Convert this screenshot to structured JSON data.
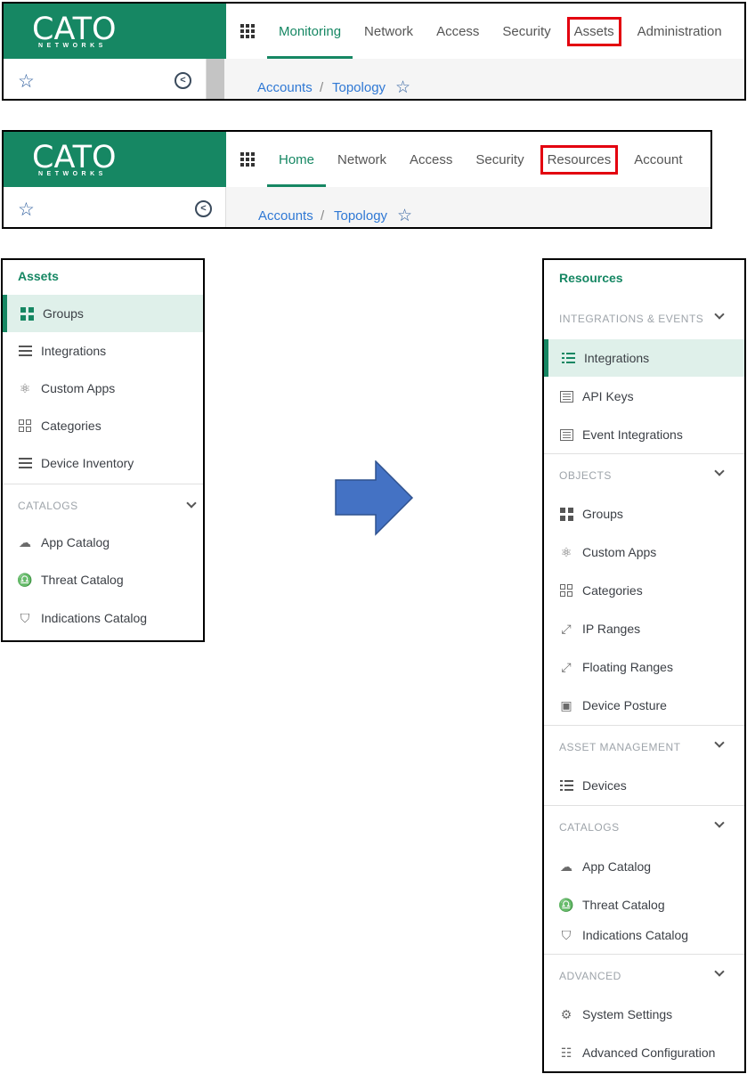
{
  "old_header": {
    "logo": {
      "word": "CATO",
      "sub": "NETWORKS"
    },
    "tabs": [
      "Monitoring",
      "Network",
      "Access",
      "Security",
      "Assets",
      "Administration"
    ],
    "breadcrumb": [
      "Accounts",
      "/",
      "Topology"
    ]
  },
  "new_header": {
    "logo": {
      "word": "CATO",
      "sub": "NETWORKS"
    },
    "tabs": [
      "Home",
      "Network",
      "Access",
      "Security",
      "Resources",
      "Account"
    ],
    "breadcrumb": [
      "Accounts",
      "/",
      "Topology"
    ]
  },
  "assets_panel": {
    "title": "Assets",
    "items": [
      "Groups",
      "Integrations",
      "Custom Apps",
      "Categories",
      "Device Inventory"
    ],
    "catalogs_header": "CATALOGS",
    "catalog_items": [
      "App Catalog",
      "Threat Catalog",
      "Indications Catalog"
    ]
  },
  "resources_panel": {
    "title": "Resources",
    "sections": [
      {
        "header": "INTEGRATIONS & EVENTS",
        "items": [
          "Integrations",
          "API Keys",
          "Event Integrations"
        ]
      },
      {
        "header": "OBJECTS",
        "items": [
          "Groups",
          "Custom Apps",
          "Categories",
          "IP Ranges",
          "Floating Ranges",
          "Device Posture"
        ]
      },
      {
        "header": "ASSET MANAGEMENT",
        "items": [
          "Devices"
        ]
      },
      {
        "header": "CATALOGS",
        "items": [
          "App Catalog",
          "Threat Catalog",
          "Indications Catalog"
        ]
      },
      {
        "header": "ADVANCED",
        "items": [
          "System Settings",
          "Advanced Configuration"
        ]
      }
    ]
  },
  "colors": {
    "brand": "#168763",
    "highlight": "#e3000f",
    "arrow": "#4472c4",
    "link": "#2f78d4"
  }
}
